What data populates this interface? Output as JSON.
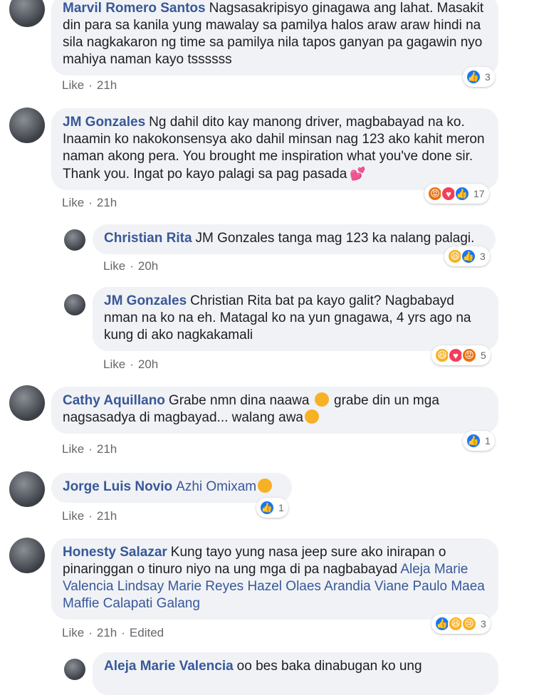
{
  "comments": [
    {
      "author": "Marvil Romero Santos",
      "text": "Nagsasakripisyo ginagawa ang lahat. Masakit din para sa kanila yung mawalay sa pamilya halos araw araw hindi na sila nagkakaron ng time sa pamilya nila tapos ganyan pa gagawin nyo mahiya naman kayo tssssss",
      "like_label": "Like",
      "time": "21h",
      "reaction_count": "3"
    },
    {
      "author": "JM Gonzales",
      "text": "Ng dahil dito kay manong driver, magbabayad na ko. Inaamin ko nakokonsensya ako dahil minsan nag 123 ako kahit meron naman akong pera. You brought me inspiration what you've done sir. Thank you. Ingat po kayo palagi sa pag pasada",
      "like_label": "Like",
      "time": "21h",
      "reaction_count": "17"
    },
    {
      "author": "Christian Rita",
      "text": "JM Gonzales tanga mag 123 ka nalang palagi.",
      "like_label": "Like",
      "time": "20h",
      "reaction_count": "3"
    },
    {
      "author": "JM Gonzales",
      "text": "Christian Rita bat pa kayo galit? Nagbabayd nman na ko na eh. Matagal ko na yun gnagawa, 4 yrs ago na kung di ako nagkakamali",
      "like_label": "Like",
      "time": "20h",
      "reaction_count": "5"
    },
    {
      "author": "Cathy Aquillano",
      "text_part1": "Grabe nmn dina naawa",
      "text_part2": "grabe din un mga nagsasadya di magbayad... walang awa",
      "like_label": "Like",
      "time": "21h",
      "reaction_count": "1"
    },
    {
      "author": "Jorge Luis Novio",
      "text": "Azhi Omixam",
      "like_label": "Like",
      "time": "21h",
      "reaction_count": "1"
    },
    {
      "author": "Honesty Salazar",
      "text": "Kung tayo yung nasa jeep sure ako inirapan o pinaringgan o tinuro niyo na ung mga di pa nagbabayad",
      "mentions": "Aleja Marie Valencia Lindsay Marie Reyes Hazel Olaes Arandia Viane Paulo Maea Maffie Calapati Galang",
      "like_label": "Like",
      "time": "21h",
      "edited": "Edited",
      "reaction_count": "3"
    },
    {
      "author": "Aleja Marie Valencia",
      "text": "oo bes baka dinabugan ko ung"
    }
  ],
  "separator": "·"
}
